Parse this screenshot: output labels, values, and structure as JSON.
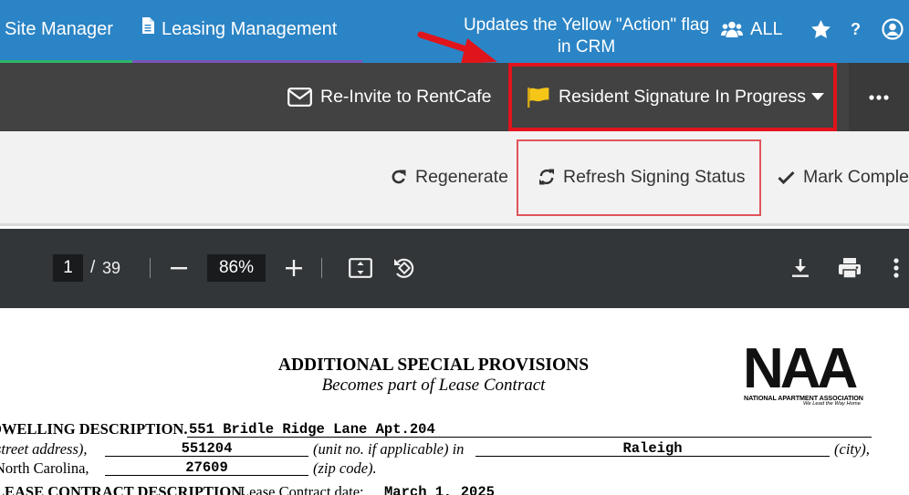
{
  "topnav": {
    "tabs": [
      {
        "label": "Site Manager"
      },
      {
        "label": "Leasing Management"
      }
    ],
    "annotation_text": "Updates the Yellow \"Action\" flag in CRM",
    "all_label": "ALL",
    "help_label": "?"
  },
  "actionbar": {
    "reinvite_label": "Re-Invite to RentCafe",
    "status_label": "Resident Signature In Progress",
    "more_label": "•••"
  },
  "toolbar": {
    "regenerate_label": "Regenerate",
    "refresh_label": "Refresh Signing Status",
    "mark_complete_label": "Mark Comple"
  },
  "pdf_viewer": {
    "current_page": "1",
    "page_separator": "/",
    "total_pages": "39",
    "zoom": "86%"
  },
  "document": {
    "title": "ADDITIONAL SPECIAL PROVISIONS",
    "subtitle": "Becomes part of Lease Contract",
    "logo": {
      "big": "NAA",
      "small": "NATIONAL APARTMENT ASSOCIATION",
      "tagline": "We Lead the Way Home"
    },
    "dwelling_label": "DWELLING DESCRIPTION.",
    "street_address": "551 Bridle Ridge Lane Apt.204",
    "street_suffix": "street address),",
    "unit_no": "551204",
    "unit_label": "(unit no. if applicable) in",
    "city": "Raleigh",
    "city_label": "(city),",
    "state": "North Carolina,",
    "zip": "27609",
    "zip_label": "(zip code).",
    "lease_label": "LEASE CONTRACT DESCRIPTION.",
    "lease_date_label": "Lease Contract date:",
    "lease_date": "March 1, 2025"
  },
  "colors": {
    "nav_blue": "#2b84c5",
    "action_bar": "#424242",
    "highlight_red": "#e0141b",
    "flag_yellow": "#f5c518"
  }
}
